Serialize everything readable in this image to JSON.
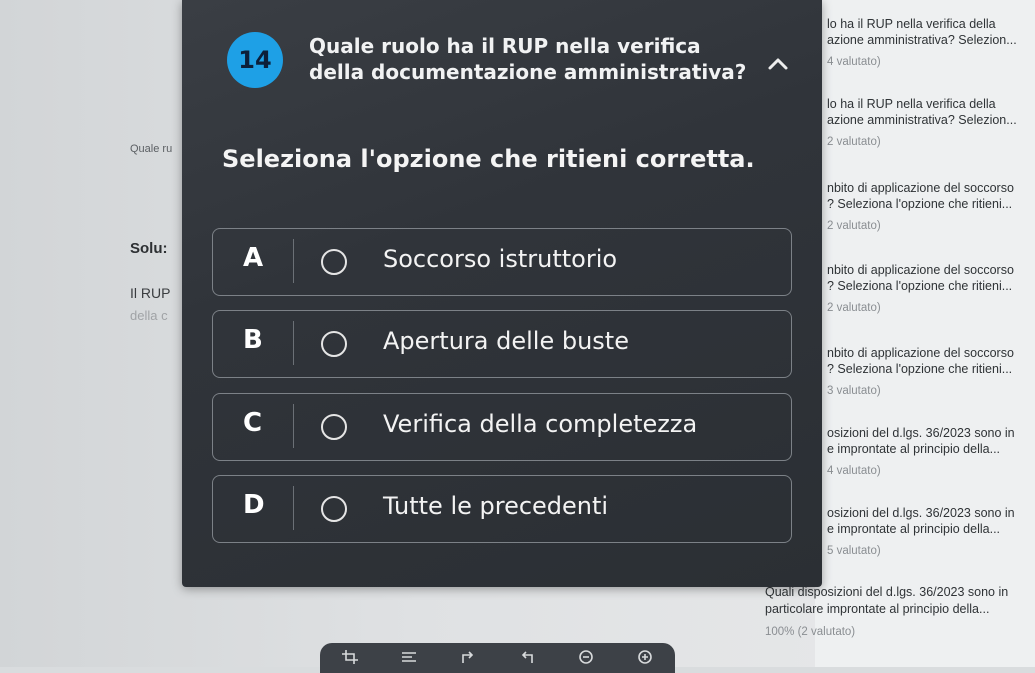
{
  "background_page": {
    "fragments": [
      "Quale ru",
      "Solu:",
      "Il RUP",
      "della c"
    ]
  },
  "question": {
    "number": "14",
    "title": "Quale ruolo ha il RUP nella verifica della documentazione amministrativa?",
    "instruction": "Seleziona l'opzione che ritieni corretta."
  },
  "options": [
    {
      "letter": "A",
      "text": "Soccorso istruttorio"
    },
    {
      "letter": "B",
      "text": "Apertura delle buste"
    },
    {
      "letter": "C",
      "text": "Verifica della completezza"
    },
    {
      "letter": "D",
      "text": "Tutte le precedenti"
    }
  ],
  "related_list": [
    {
      "line1": "lo ha il RUP nella verifica della",
      "line2": "azione amministrativa? Selezion...",
      "status": "4 valutato)"
    },
    {
      "line1": "lo ha il RUP nella verifica della",
      "line2": "azione amministrativa? Selezion...",
      "status": "2 valutato)"
    },
    {
      "line1": "nbito di applicazione del soccorso",
      "line2": "? Seleziona l'opzione che ritieni...",
      "status": "2 valutato)"
    },
    {
      "line1": "nbito di applicazione del soccorso",
      "line2": "? Seleziona l'opzione che ritieni...",
      "status": "2 valutato)"
    },
    {
      "line1": "nbito di applicazione del soccorso",
      "line2": "? Seleziona l'opzione che ritieni...",
      "status": "3 valutato)"
    },
    {
      "line1": "osizioni del d.lgs. 36/2023 sono in",
      "line2": "e improntate al principio della...",
      "status": "4 valutato)"
    },
    {
      "line1": "osizioni del d.lgs. 36/2023 sono in",
      "line2": "e improntate al principio della...",
      "status": "5 valutato)"
    }
  ],
  "bottom_item": {
    "line1": "Quali disposizioni del d.lgs. 36/2023 sono in",
    "line2": "particolare improntate al principio della...",
    "status": "100% (2 valutato)"
  },
  "icons": {
    "collapse": "chevron-up-icon",
    "toolbar": [
      "crop-icon",
      "align-icon",
      "rotate-icon",
      "flip-icon",
      "zoom-out-icon",
      "zoom-in-icon"
    ]
  },
  "colors": {
    "badge": "#1ea0e6",
    "panel": "#30343a"
  }
}
